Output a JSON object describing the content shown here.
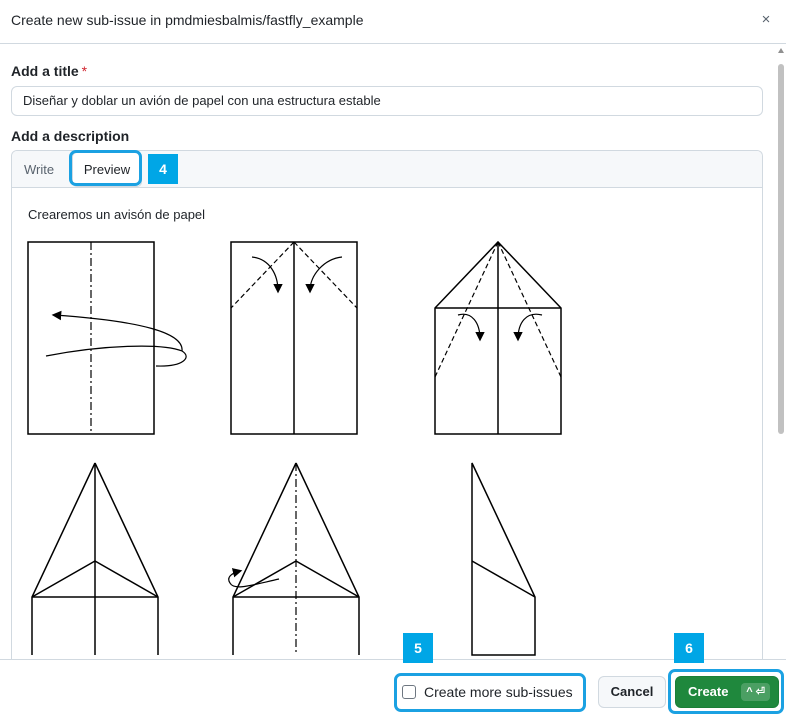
{
  "dialog": {
    "title": "Create new sub-issue in pmdmiesbalmis/fastfly_example",
    "close_icon": "close-icon",
    "close_glyph": "×"
  },
  "form": {
    "title_label": "Add a title",
    "required_mark": "*",
    "title_value": "Diseñar y doblar un avión de papel con una estructura estable",
    "description_label": "Add a description"
  },
  "tabs": [
    {
      "label": "Write",
      "selected": false
    },
    {
      "label": "Preview",
      "selected": true
    }
  ],
  "preview": {
    "text": "Crearemos un avisón de papel"
  },
  "footer": {
    "create_more_label": "Create more sub-issues",
    "create_more_checked": false,
    "cancel_label": "Cancel",
    "create_label": "Create",
    "create_shortcut": "^ ⏎"
  },
  "annotations": [
    {
      "number": "4",
      "target": "Preview tab"
    },
    {
      "number": "5",
      "target": "Create more sub-issues checkbox"
    },
    {
      "number": "6",
      "target": "Create button"
    }
  ],
  "colors": {
    "annotation": "#00a6e6",
    "primary_button": "#1f883d",
    "required": "#d1242f"
  }
}
